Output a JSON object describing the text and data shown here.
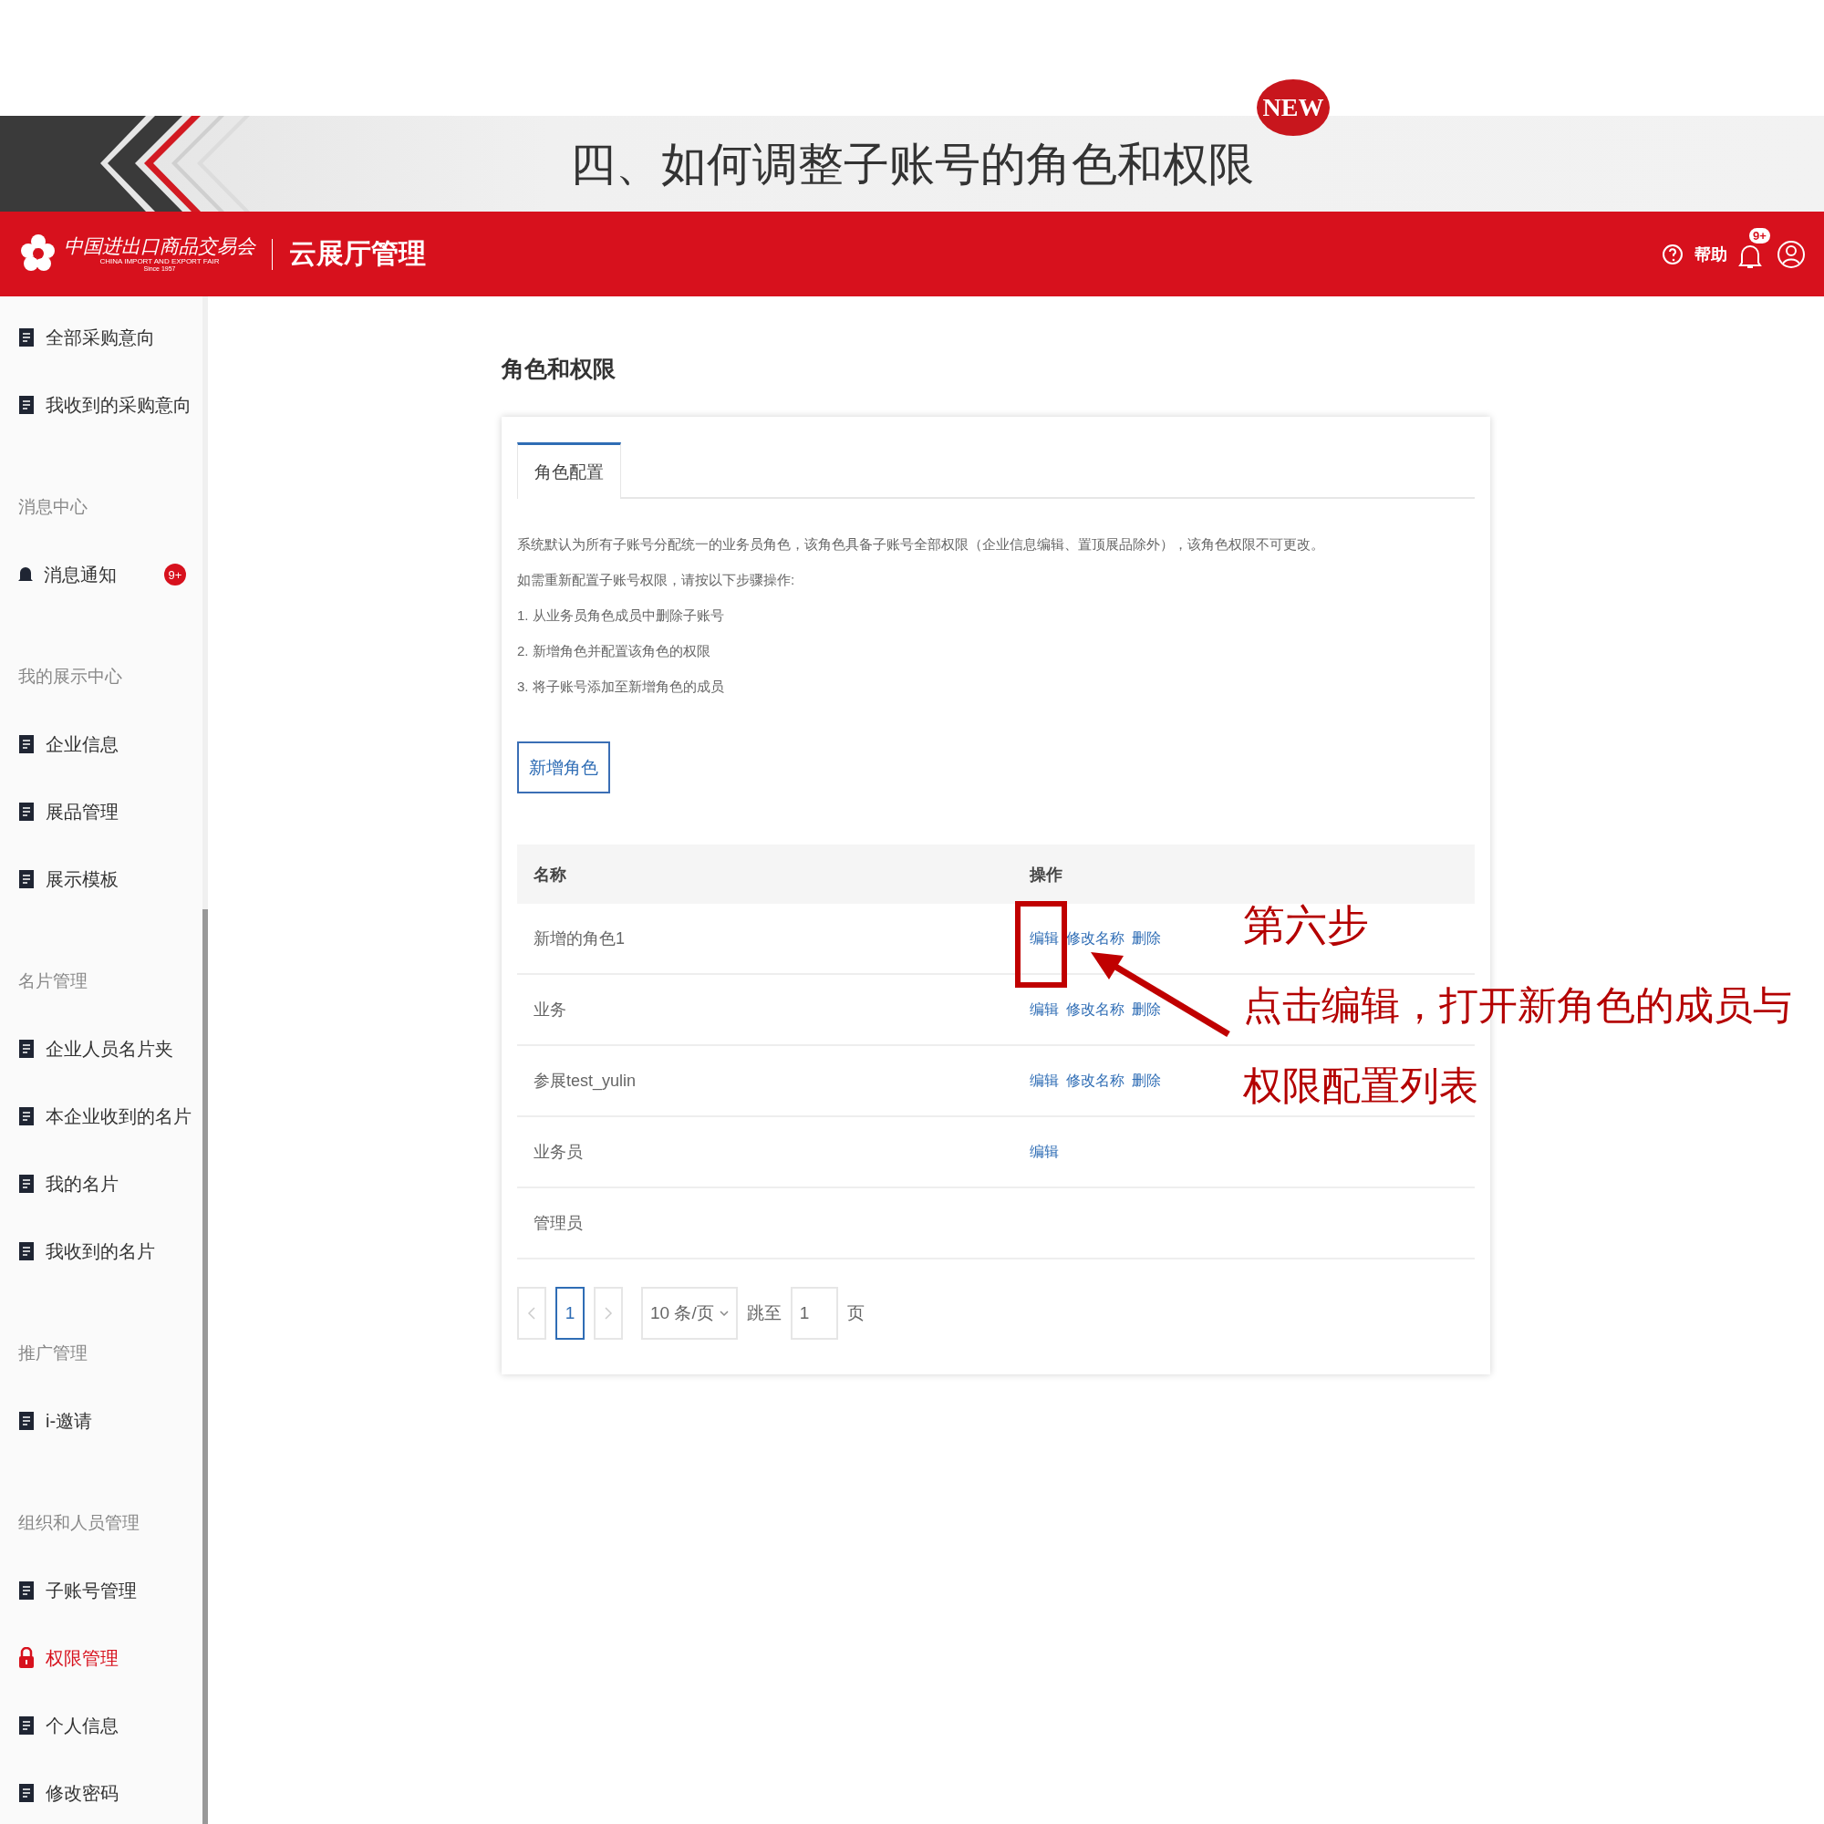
{
  "slide": {
    "title": "四、如何调整子账号的角色和权限",
    "new_badge": "NEW"
  },
  "header": {
    "logo_cn": "中国进出口商品交易会",
    "logo_en": "CHINA IMPORT AND EXPORT FAIR",
    "logo_since": "Since 1957",
    "app_name": "云展厅管理",
    "help": "帮助",
    "notification_badge": "9+"
  },
  "sidebar": {
    "items": [
      {
        "kind": "item",
        "label": "全部采购意向",
        "selected": false
      },
      {
        "kind": "item",
        "label": "我收到的采购意向",
        "selected": false
      },
      {
        "kind": "section",
        "label": "消息中心"
      },
      {
        "kind": "item",
        "label": "消息通知",
        "selected": false,
        "badge": "9+"
      },
      {
        "kind": "section",
        "label": "我的展示中心"
      },
      {
        "kind": "item",
        "label": "企业信息",
        "selected": false
      },
      {
        "kind": "item",
        "label": "展品管理",
        "selected": false
      },
      {
        "kind": "item",
        "label": "展示模板",
        "selected": false
      },
      {
        "kind": "section",
        "label": "名片管理"
      },
      {
        "kind": "item",
        "label": "企业人员名片夹",
        "selected": false
      },
      {
        "kind": "item",
        "label": "本企业收到的名片",
        "selected": false
      },
      {
        "kind": "item",
        "label": "我的名片",
        "selected": false
      },
      {
        "kind": "item",
        "label": "我收到的名片",
        "selected": false
      },
      {
        "kind": "section",
        "label": "推广管理"
      },
      {
        "kind": "item",
        "label": "i-邀请",
        "selected": false
      },
      {
        "kind": "section",
        "label": "组织和人员管理"
      },
      {
        "kind": "item",
        "label": "子账号管理",
        "selected": false
      },
      {
        "kind": "item",
        "label": "权限管理",
        "selected": true
      },
      {
        "kind": "item",
        "label": "个人信息",
        "selected": false
      },
      {
        "kind": "item",
        "label": "修改密码",
        "selected": false
      }
    ]
  },
  "page": {
    "title": "角色和权限",
    "tabs": [
      {
        "label": "角色配置",
        "selected": true
      }
    ],
    "intro": [
      "系统默认为所有子账号分配统一的业务员角色，该角色具备子账号全部权限（企业信息编辑、置顶展品除外），该角色权限不可更改。",
      "如需重新配置子账号权限，请按以下步骤操作:",
      "1. 从业务员角色成员中删除子账号",
      "2. 新增角色并配置该角色的权限",
      "3. 将子账号添加至新增角色的成员"
    ],
    "add_button": "新增角色",
    "table": {
      "columns": [
        "名称",
        "操作"
      ],
      "rows": [
        {
          "name": "新增的角色1",
          "actions": [
            "编辑",
            "修改名称",
            "删除"
          ]
        },
        {
          "name": "业务",
          "actions": [
            "编辑",
            "修改名称",
            "删除"
          ]
        },
        {
          "name": "参展test_yulin",
          "actions": [
            "编辑",
            "修改名称",
            "删除"
          ]
        },
        {
          "name": "业务员",
          "actions": [
            "编辑"
          ]
        },
        {
          "name": "管理员",
          "actions": []
        }
      ]
    },
    "pagination": {
      "pages": [
        {
          "label": "1",
          "selected": true
        }
      ],
      "page_size": "10 条/页",
      "goto_label": "跳至",
      "goto_value": "1",
      "page_unit": "页"
    }
  },
  "annotation": {
    "step": "第六步",
    "text": "点击编辑，打开新角色的成员与权限配置列表"
  }
}
